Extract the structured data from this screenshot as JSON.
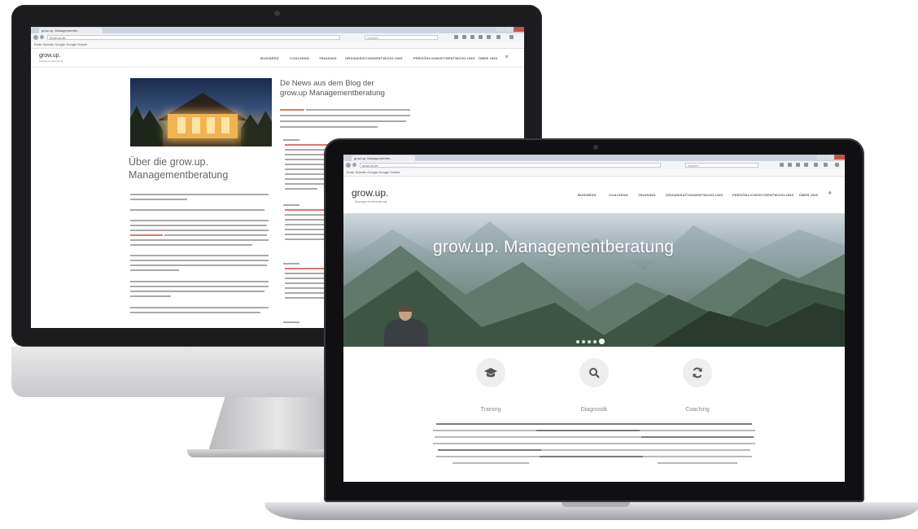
{
  "imac": {
    "browser": {
      "tab_title": "grow.up. Managementbe...",
      "url": "grow.up.de",
      "search_placeholder": "Suchen",
      "bookmarks": "Erste Schritte   Google   Google Schule"
    },
    "site": {
      "logo": "grow.up.",
      "logo_sub": "Managementberatung",
      "nav": [
        "BUSINESS",
        "COACHING",
        "TRAINING",
        "ORGANISATIONSENTWICKLUNG",
        "PERSÖNLICHKEITSENTWICKLUNG",
        "ÜBER UNS"
      ]
    },
    "blog_title": "De News aus dem Blog der grow.up Managementberatung",
    "about_title": "Über die grow.up. Managementberatung"
  },
  "macbook": {
    "browser": {
      "tab_title": "grow.up. Managementbe...",
      "url": "grow.up.de",
      "search_placeholder": "Suchen",
      "bookmarks": "Erste Schritte   Google   Google Schule"
    },
    "site": {
      "logo": "grow.up.",
      "logo_sub": "Managementberatung",
      "nav": [
        "BUSINESS",
        "COACHING",
        "TRAINING",
        "ORGANISATIONSENTWICKLUNG",
        "PERSÖNLICHKEITSENTWICKLUNG",
        "ÜBER UNS"
      ]
    },
    "banner_title": "grow.up. Managementberatung",
    "slider_dots": 5,
    "slider_active": 4,
    "features": [
      {
        "title": "Training",
        "icon": "graduation-cap-icon"
      },
      {
        "title": "Diagnostik",
        "icon": "search-icon"
      },
      {
        "title": "Coaching",
        "icon": "refresh-icon"
      }
    ]
  },
  "colors": {
    "accent": "#d64a3b",
    "device_dark": "#1c1c1e",
    "aluminum": "#c9cacd"
  }
}
